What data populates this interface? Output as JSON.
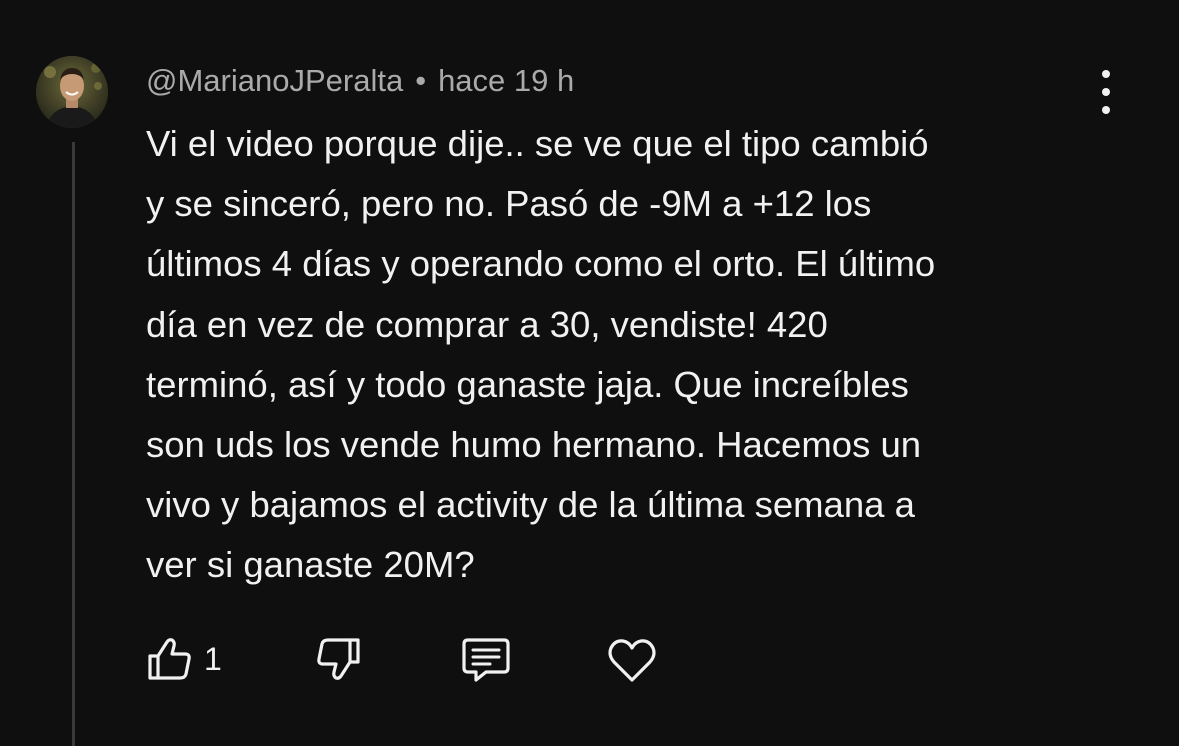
{
  "comment": {
    "author": "@MarianoJPeralta",
    "separator": "•",
    "time": "hace 19 h",
    "lines": [
      "Vi el video porque dije.. se ve que el tipo cambió",
      "y se sinceró, pero no. Pasó de -9M a +12 los",
      "últimos 4 días y operando como el orto. El último",
      "día en vez de comprar a 30, vendiste! 420",
      "terminó, así y todo ganaste jaja. Que increíbles",
      "son uds los vende humo hermano. Hacemos un",
      "vivo y bajamos el activity de la última semana a",
      "ver si ganaste 20M?"
    ]
  },
  "actions": {
    "like_count": "1",
    "icons": {
      "like": "thumbs-up-icon",
      "dislike": "thumbs-down-icon",
      "reply": "comment-icon",
      "heart": "heart-icon",
      "menu": "more-vertical-icon"
    }
  },
  "colors": {
    "background": "#0f0f0f",
    "text": "#f1f1f1",
    "meta": "#aaaaaa",
    "thread_line": "#3a3a3a"
  }
}
